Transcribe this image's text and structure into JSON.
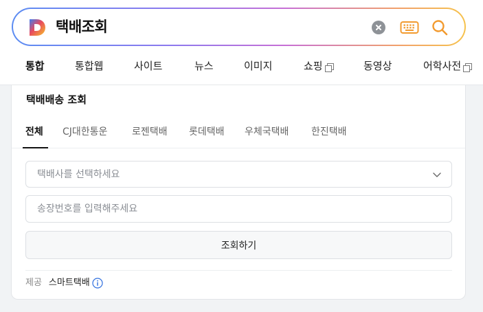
{
  "search": {
    "query": "택배조회",
    "clear_icon": "clear-icon",
    "keyboard_icon": "keyboard-icon",
    "search_icon": "search-icon"
  },
  "nav_tabs": [
    {
      "label": "통합",
      "active": true
    },
    {
      "label": "통합웹",
      "active": false
    },
    {
      "label": "사이트",
      "active": false
    },
    {
      "label": "뉴스",
      "active": false
    },
    {
      "label": "이미지",
      "active": false
    },
    {
      "label": "쇼핑",
      "active": false,
      "external": true
    },
    {
      "label": "동영상",
      "active": false
    },
    {
      "label": "어학사전",
      "active": false,
      "external": true
    }
  ],
  "tracker": {
    "title": "택배배송 조회",
    "carrier_tabs": [
      {
        "label": "전체",
        "active": true
      },
      {
        "label": "CJ대한통운",
        "active": false
      },
      {
        "label": "로젠택배",
        "active": false
      },
      {
        "label": "롯데택배",
        "active": false
      },
      {
        "label": "우체국택배",
        "active": false
      },
      {
        "label": "한진택배",
        "active": false
      }
    ],
    "carrier_select_placeholder": "택배사를 선택하세요",
    "tracking_input_placeholder": "송장번호를 입력해주세요",
    "submit_label": "조회하기",
    "provider_label": "제공",
    "provider_name": "스마트택배"
  },
  "colors": {
    "keyboard_accent": "#f29a2e",
    "search_accent": "#f29a2e",
    "info_accent": "#2f6fde"
  }
}
